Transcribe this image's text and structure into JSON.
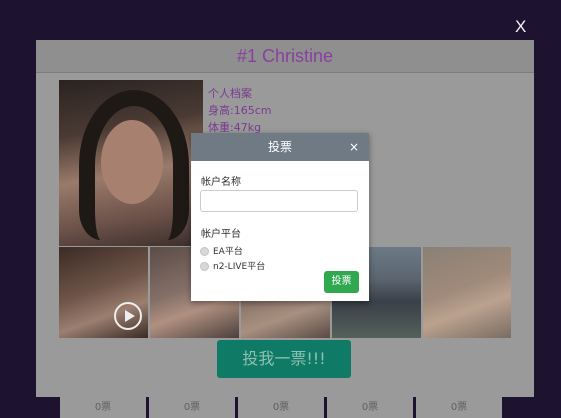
{
  "overlay": {
    "close_label": "X"
  },
  "profile_modal": {
    "title": "#1 Christine",
    "details": [
      "个人档案",
      "身高:165cm",
      "体重:47kg"
    ],
    "vote_button_label": "投我一票!!!",
    "tallies": [
      "0票",
      "0票",
      "0票",
      "0票",
      "0票"
    ]
  },
  "vote_dialog": {
    "title": "投票",
    "close_label": "×",
    "account_name_label": "帐户名称",
    "account_name_value": "",
    "platform_label": "帐户平台",
    "platform_options": [
      "EA平台",
      "n2-LIVE平台"
    ],
    "submit_label": "投票"
  }
}
